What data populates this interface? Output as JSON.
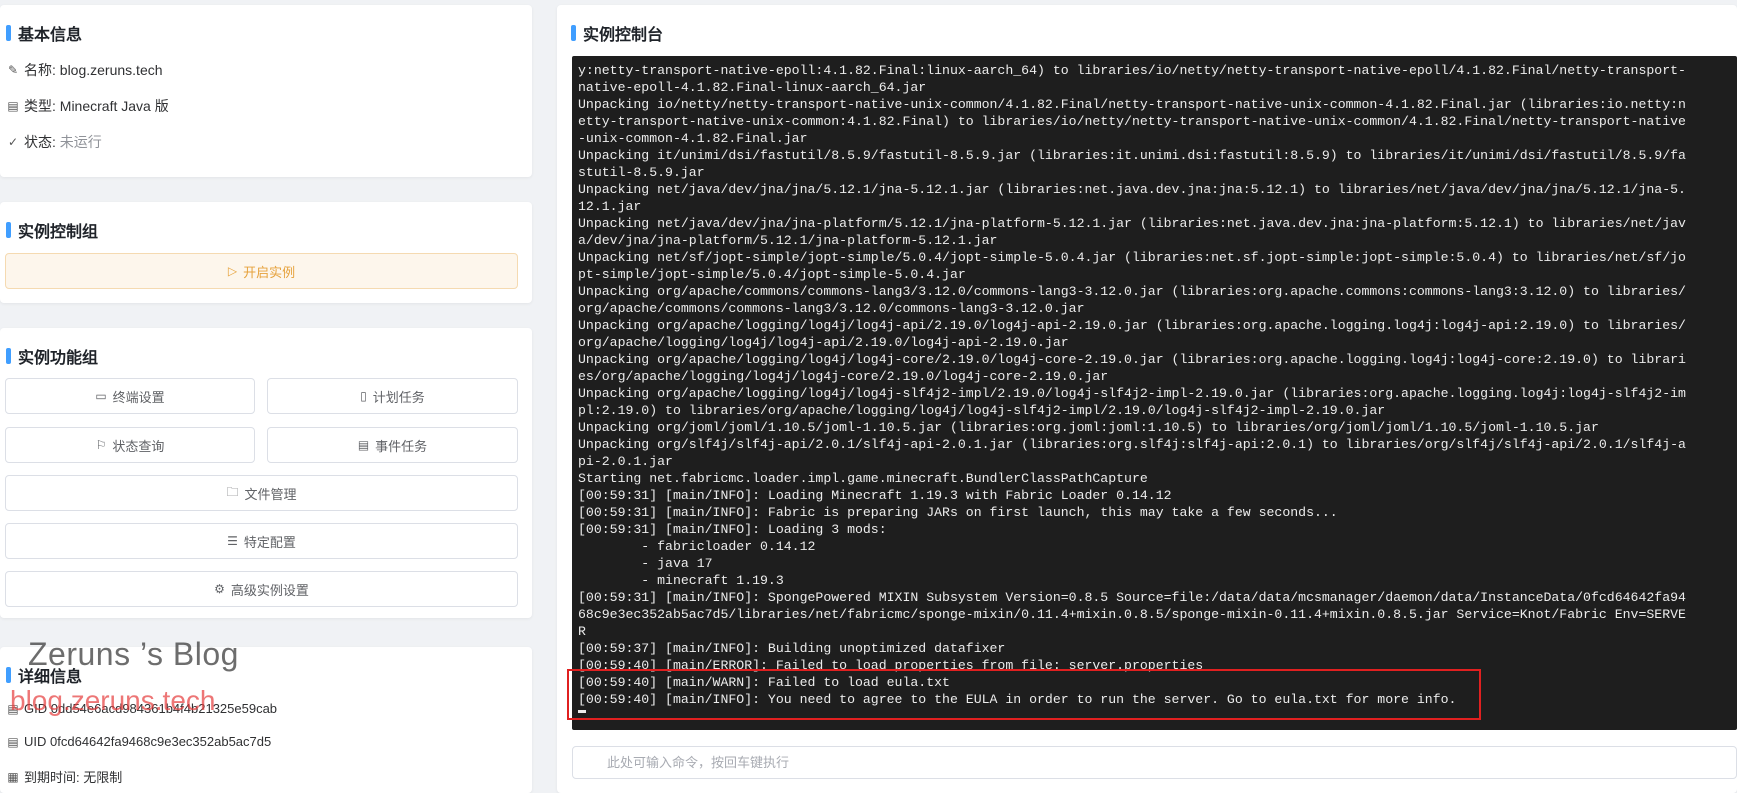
{
  "basic_info": {
    "title": "基本信息",
    "name_label": "名称:",
    "name_value": "blog.zeruns.tech",
    "type_label": "类型:",
    "type_value": "Minecraft Java 版",
    "status_label": "状态:",
    "status_value": "未运行"
  },
  "control_group": {
    "title": "实例控制组",
    "start_label": "开启实例"
  },
  "function_group": {
    "title": "实例功能组",
    "terminal_settings": "终端设置",
    "scheduled_tasks": "计划任务",
    "status_query": "状态查询",
    "event_tasks": "事件任务",
    "file_management": "文件管理",
    "specific_config": "特定配置",
    "advanced_settings": "高级实例设置"
  },
  "detail_info": {
    "title": "详细信息",
    "gid_label": "GID",
    "gid_value": "0dd54e6acd984361b4f4b21325e59cab",
    "uid_label": "UID",
    "uid_value": "0fcd64642fa9468c9e3ec352ab5ac7d5",
    "expire_label": "到期时间:",
    "expire_value": "无限制"
  },
  "console": {
    "title": "实例控制台",
    "lines": [
      "y:netty-transport-native-epoll:4.1.82.Final:linux-aarch_64) to libraries/io/netty/netty-transport-native-epoll/4.1.82.Final/netty-transport-",
      "native-epoll-4.1.82.Final-linux-aarch_64.jar",
      "Unpacking io/netty/netty-transport-native-unix-common/4.1.82.Final/netty-transport-native-unix-common-4.1.82.Final.jar (libraries:io.netty:n",
      "etty-transport-native-unix-common:4.1.82.Final) to libraries/io/netty/netty-transport-native-unix-common/4.1.82.Final/netty-transport-native",
      "-unix-common-4.1.82.Final.jar",
      "Unpacking it/unimi/dsi/fastutil/8.5.9/fastutil-8.5.9.jar (libraries:it.unimi.dsi:fastutil:8.5.9) to libraries/it/unimi/dsi/fastutil/8.5.9/fa",
      "stutil-8.5.9.jar",
      "Unpacking net/java/dev/jna/jna/5.12.1/jna-5.12.1.jar (libraries:net.java.dev.jna:jna:5.12.1) to libraries/net/java/dev/jna/jna/5.12.1/jna-5.",
      "12.1.jar",
      "Unpacking net/java/dev/jna/jna-platform/5.12.1/jna-platform-5.12.1.jar (libraries:net.java.dev.jna:jna-platform:5.12.1) to libraries/net/jav",
      "a/dev/jna/jna-platform/5.12.1/jna-platform-5.12.1.jar",
      "Unpacking net/sf/jopt-simple/jopt-simple/5.0.4/jopt-simple-5.0.4.jar (libraries:net.sf.jopt-simple:jopt-simple:5.0.4) to libraries/net/sf/jo",
      "pt-simple/jopt-simple/5.0.4/jopt-simple-5.0.4.jar",
      "Unpacking org/apache/commons/commons-lang3/3.12.0/commons-lang3-3.12.0.jar (libraries:org.apache.commons:commons-lang3:3.12.0) to libraries/",
      "org/apache/commons/commons-lang3/3.12.0/commons-lang3-3.12.0.jar",
      "Unpacking org/apache/logging/log4j/log4j-api/2.19.0/log4j-api-2.19.0.jar (libraries:org.apache.logging.log4j:log4j-api:2.19.0) to libraries/",
      "org/apache/logging/log4j/log4j-api/2.19.0/log4j-api-2.19.0.jar",
      "Unpacking org/apache/logging/log4j/log4j-core/2.19.0/log4j-core-2.19.0.jar (libraries:org.apache.logging.log4j:log4j-core:2.19.0) to librari",
      "es/org/apache/logging/log4j/log4j-core/2.19.0/log4j-core-2.19.0.jar",
      "Unpacking org/apache/logging/log4j/log4j-slf4j2-impl/2.19.0/log4j-slf4j2-impl-2.19.0.jar (libraries:org.apache.logging.log4j:log4j-slf4j2-im",
      "pl:2.19.0) to libraries/org/apache/logging/log4j/log4j-slf4j2-impl/2.19.0/log4j-slf4j2-impl-2.19.0.jar",
      "Unpacking org/joml/joml/1.10.5/joml-1.10.5.jar (libraries:org.joml:joml:1.10.5) to libraries/org/joml/joml/1.10.5/joml-1.10.5.jar",
      "Unpacking org/slf4j/slf4j-api/2.0.1/slf4j-api-2.0.1.jar (libraries:org.slf4j:slf4j-api:2.0.1) to libraries/org/slf4j/slf4j-api/2.0.1/slf4j-a",
      "pi-2.0.1.jar",
      "Starting net.fabricmc.loader.impl.game.minecraft.BundlerClassPathCapture",
      "[00:59:31] [main/INFO]: Loading Minecraft 1.19.3 with Fabric Loader 0.14.12",
      "[00:59:31] [main/INFO]: Fabric is preparing JARs on first launch, this may take a few seconds...",
      "[00:59:31] [main/INFO]: Loading 3 mods:",
      "        - fabricloader 0.14.12",
      "        - java 17",
      "        - minecraft 1.19.3",
      "[00:59:31] [main/INFO]: SpongePowered MIXIN Subsystem Version=0.8.5 Source=file:/data/data/mcsmanager/daemon/data/InstanceData/0fcd64642fa94",
      "68c9e3ec352ab5ac7d5/libraries/net/fabricmc/sponge-mixin/0.11.4+mixin.0.8.5/sponge-mixin-0.11.4+mixin.0.8.5.jar Service=Knot/Fabric Env=SERVE",
      "R",
      "[00:59:37] [main/INFO]: Building unoptimized datafixer",
      "[00:59:40] [main/ERROR]: Failed to load properties from file: server.properties",
      "[00:59:40] [main/WARN]: Failed to load eula.txt",
      "[00:59:40] [main/INFO]: You need to agree to the EULA in order to run the server. Go to eula.txt for more info."
    ],
    "input_placeholder": "此处可输入命令，按回车键执行"
  },
  "watermark": {
    "line1": "Zeruns ’s Blog",
    "line2": "blog.zeruns.tech"
  }
}
